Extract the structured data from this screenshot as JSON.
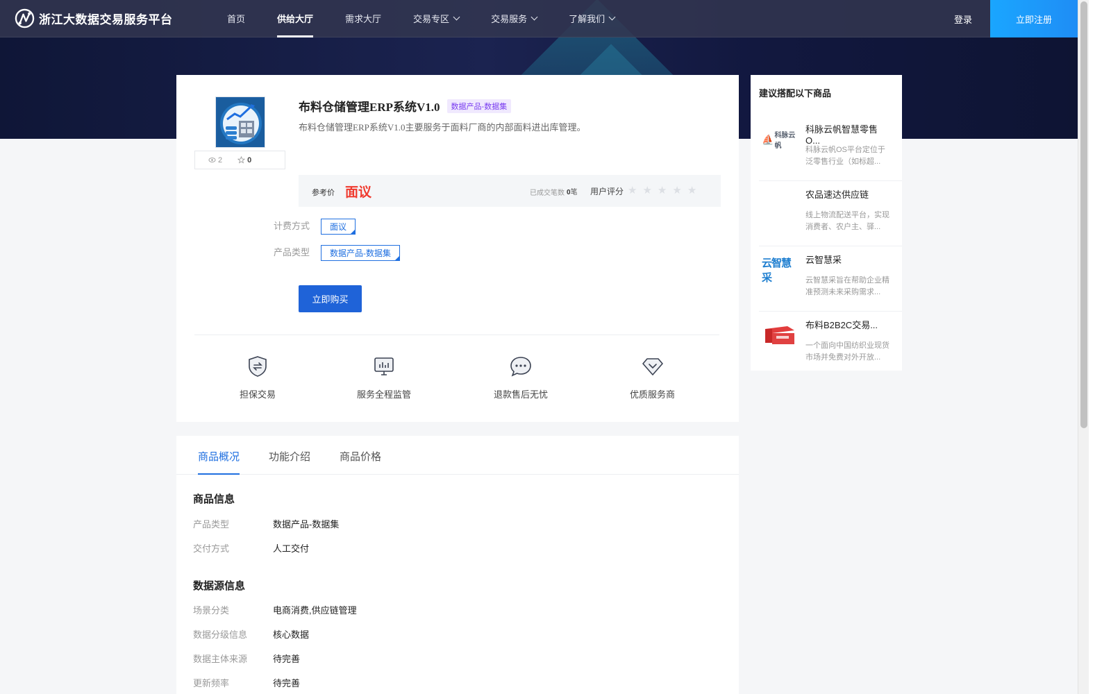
{
  "header": {
    "logo_text": "浙江大数据交易服务平台",
    "nav": [
      {
        "label": "首页"
      },
      {
        "label": "供给大厅"
      },
      {
        "label": "需求大厅"
      },
      {
        "label": "交易专区"
      },
      {
        "label": "交易服务"
      },
      {
        "label": "了解我们"
      }
    ],
    "login": "登录",
    "register": "立即注册"
  },
  "product": {
    "title": "布料仓储管理ERP系统V1.0",
    "category_tag": "数据产品-数据集",
    "description": "布料仓储管理ERP系统V1.0主要服务于面料厂商的内部面料进出库管理。",
    "views": "2",
    "favorites": "0",
    "price_label": "参考价",
    "price_value": "面议",
    "deal_label": "已成交笔数",
    "deal_count": "0",
    "deal_unit": "笔",
    "rating_label": "用户评分",
    "rating": 0,
    "billing_label": "计费方式",
    "billing_value": "面议",
    "type_label": "产品类型",
    "type_value": "数据产品-数据集",
    "buy_button": "立即购买"
  },
  "guarantees": [
    {
      "label": "担保交易",
      "icon": "shield-exchange-icon"
    },
    {
      "label": "服务全程监管",
      "icon": "monitor-chart-icon"
    },
    {
      "label": "退款售后无忧",
      "icon": "chat-bubble-icon"
    },
    {
      "label": "优质服务商",
      "icon": "diamond-check-icon"
    }
  ],
  "recommendations": {
    "title": "建议搭配以下商品",
    "items": [
      {
        "name": "科脉云帆智慧零售O...",
        "desc": "科脉云帆OS平台定位于泛零售行业（如标超...",
        "logo_text": "科脉云帆"
      },
      {
        "name": "农品速达供应链",
        "desc": "线上物流配送平台，实现消费者、农户主、驿...",
        "logo_text": ""
      },
      {
        "name": "云智慧采",
        "desc": "云智慧采旨在帮助企业精准预测未来采购需求...",
        "logo_text": "云智慧采"
      },
      {
        "name": "布料B2B2C交易...",
        "desc": "一个面向中国纺织业现货市场并免费对外开放...",
        "logo_text": ""
      }
    ]
  },
  "tabs": [
    {
      "label": "商品概况"
    },
    {
      "label": "功能介绍"
    },
    {
      "label": "商品价格"
    }
  ],
  "info": {
    "product_info_title": "商品信息",
    "product_info": [
      {
        "key": "产品类型",
        "value": "数据产品-数据集"
      },
      {
        "key": "交付方式",
        "value": "人工交付"
      }
    ],
    "source_info_title": "数据源信息",
    "source_info": [
      {
        "key": "场景分类",
        "value": "电商消费,供应链管理"
      },
      {
        "key": "数据分级信息",
        "value": "核心数据"
      },
      {
        "key": "数据主体来源",
        "value": "待完善"
      },
      {
        "key": "更新频率",
        "value": "待完善"
      }
    ]
  },
  "colors": {
    "accent": "#1f6fe0",
    "price": "#f03a2e",
    "register": "#1f8df5"
  }
}
